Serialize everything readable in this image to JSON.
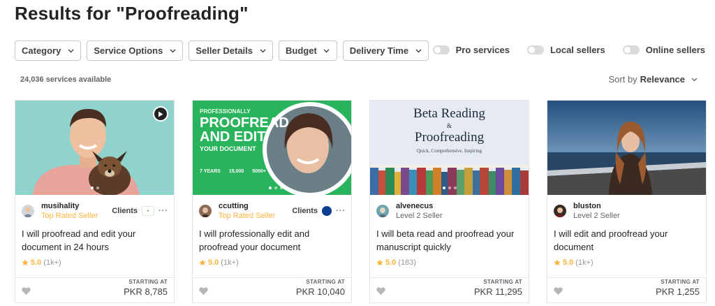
{
  "title": "Results for \"Proofreading\"",
  "filters": [
    "Category",
    "Service Options",
    "Seller Details",
    "Budget",
    "Delivery Time"
  ],
  "toggles": [
    "Pro services",
    "Local sellers",
    "Online sellers"
  ],
  "count": "24,036 services available",
  "sort": {
    "label": "Sort by",
    "value": "Relevance"
  },
  "cards": [
    {
      "seller": "musihality",
      "level": "Top Rated Seller",
      "clients_label": "Clients",
      "title": "I will proofread and edit your document in 24 hours",
      "score": "5.0",
      "reviews": "(1k+)",
      "starting": "STARTING AT",
      "price": "PKR 8,785"
    },
    {
      "seller": "ccutting",
      "level": "Top Rated Seller",
      "clients_label": "Clients",
      "title": "I will professionally edit and proofread your document",
      "score": "5.0",
      "reviews": "(1k+)",
      "starting": "STARTING AT",
      "price": "PKR 10,040"
    },
    {
      "seller": "alvenecus",
      "level": "Level 2 Seller",
      "title": "I will beta read and proofread your manuscript quickly",
      "score": "5.0",
      "reviews": "(183)",
      "starting": "STARTING AT",
      "price": "PKR 11,295"
    },
    {
      "seller": "bluston",
      "level": "Level 2 Seller",
      "title": "I will edit and proofread your document",
      "score": "5.0",
      "reviews": "(1k+)",
      "starting": "STARTING AT",
      "price": "PKR 1,255"
    }
  ],
  "thumb2": {
    "line1": "PROFESSIONALLY",
    "line2": "PROOFREAD",
    "line3": "AND EDIT",
    "line4": "YOUR DOCUMENT",
    "s1": "7 YEARS",
    "s2": "15,000",
    "s3": "5000+"
  },
  "thumb3": {
    "line1": "Beta Reading",
    "amp": "&",
    "line2": "Proofreading",
    "tag": "Quick, Comprehensive, Inspiring"
  },
  "colors": {
    "gold": "#ffb33e",
    "green": "#1dbf73",
    "teal": "#8fd3cc"
  }
}
